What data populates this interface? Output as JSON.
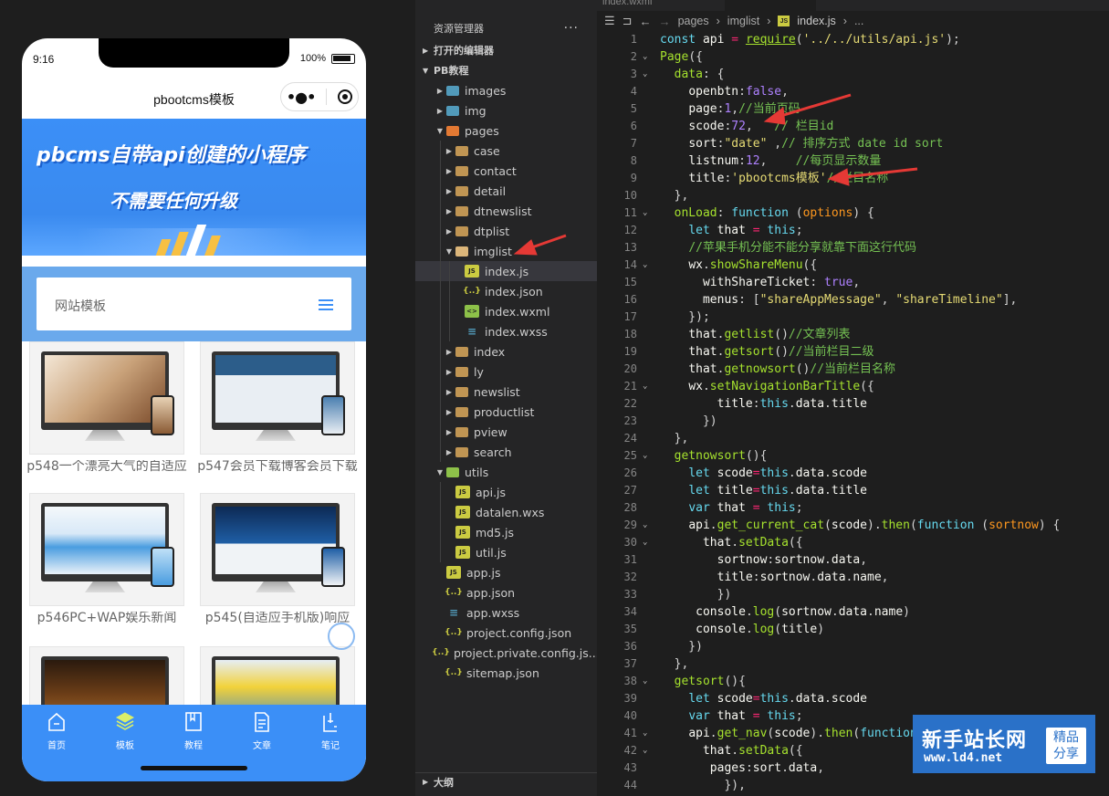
{
  "simulator": {
    "time": "9:16",
    "battery": "100%",
    "nav_title": "pbootcms模板",
    "banner_line1": "pbcms自带api创建的小程序",
    "banner_line2": "不需要任何升级",
    "section_title": "网站模板",
    "items": [
      {
        "label": "p548一个漂亮大气的自适应"
      },
      {
        "label": "p547会员下载博客会员下载"
      },
      {
        "label": "p546PC+WAP娱乐新闻"
      },
      {
        "label": "p545(自适应手机版)响应"
      },
      {
        "label": ""
      },
      {
        "label": ""
      }
    ],
    "tabs": [
      {
        "label": "首页",
        "icon": "home-icon"
      },
      {
        "label": "模板",
        "icon": "layers-icon"
      },
      {
        "label": "教程",
        "icon": "book-icon"
      },
      {
        "label": "文章",
        "icon": "document-icon"
      },
      {
        "label": "笔记",
        "icon": "note-icon"
      }
    ],
    "accent": "#3b8ff7"
  },
  "explorer": {
    "header": "资源管理器",
    "more": "···",
    "open_editors": "打开的编辑器",
    "project": "PB教程",
    "outline": "大纲",
    "tree": [
      {
        "label": "images",
        "depth": 1,
        "type": "folder-img",
        "arrow": "›"
      },
      {
        "label": "img",
        "depth": 1,
        "type": "folder-img",
        "arrow": "›"
      },
      {
        "label": "pages",
        "depth": 1,
        "type": "folder-pages",
        "arrow": "⌄"
      },
      {
        "label": "case",
        "depth": 2,
        "type": "folder",
        "arrow": "›"
      },
      {
        "label": "contact",
        "depth": 2,
        "type": "folder",
        "arrow": "›"
      },
      {
        "label": "detail",
        "depth": 2,
        "type": "folder",
        "arrow": "›"
      },
      {
        "label": "dtnewslist",
        "depth": 2,
        "type": "folder",
        "arrow": "›"
      },
      {
        "label": "dtplist",
        "depth": 2,
        "type": "folder",
        "arrow": "›"
      },
      {
        "label": "imglist",
        "depth": 2,
        "type": "folder-open",
        "arrow": "⌄"
      },
      {
        "label": "index.js",
        "depth": 3,
        "type": "js",
        "arrow": "",
        "selected": true
      },
      {
        "label": "index.json",
        "depth": 3,
        "type": "json",
        "arrow": ""
      },
      {
        "label": "index.wxml",
        "depth": 3,
        "type": "wxml",
        "arrow": ""
      },
      {
        "label": "index.wxss",
        "depth": 3,
        "type": "wxss",
        "arrow": ""
      },
      {
        "label": "index",
        "depth": 2,
        "type": "folder",
        "arrow": "›"
      },
      {
        "label": "ly",
        "depth": 2,
        "type": "folder",
        "arrow": "›"
      },
      {
        "label": "newslist",
        "depth": 2,
        "type": "folder",
        "arrow": "›"
      },
      {
        "label": "productlist",
        "depth": 2,
        "type": "folder",
        "arrow": "›"
      },
      {
        "label": "pview",
        "depth": 2,
        "type": "folder",
        "arrow": "›"
      },
      {
        "label": "search",
        "depth": 2,
        "type": "folder",
        "arrow": "›"
      },
      {
        "label": "utils",
        "depth": 1,
        "type": "folder-utils",
        "arrow": "⌄"
      },
      {
        "label": "api.js",
        "depth": 2,
        "type": "js",
        "arrow": ""
      },
      {
        "label": "datalen.wxs",
        "depth": 2,
        "type": "js",
        "arrow": ""
      },
      {
        "label": "md5.js",
        "depth": 2,
        "type": "js",
        "arrow": ""
      },
      {
        "label": "util.js",
        "depth": 2,
        "type": "js",
        "arrow": ""
      },
      {
        "label": "app.js",
        "depth": 1,
        "type": "js",
        "arrow": ""
      },
      {
        "label": "app.json",
        "depth": 1,
        "type": "json",
        "arrow": ""
      },
      {
        "label": "app.wxss",
        "depth": 1,
        "type": "wxss",
        "arrow": ""
      },
      {
        "label": "project.config.json",
        "depth": 1,
        "type": "json",
        "arrow": ""
      },
      {
        "label": "project.private.config.js...",
        "depth": 1,
        "type": "json",
        "arrow": ""
      },
      {
        "label": "sitemap.json",
        "depth": 1,
        "type": "json",
        "arrow": ""
      }
    ]
  },
  "editor": {
    "tab_inactive": "index.wxml",
    "tab_active": "index.js",
    "breadcrumb": [
      "pages",
      "imglist",
      "index.js",
      "..."
    ],
    "lines": [
      {
        "n": "1",
        "fold": "",
        "html": "<span class='k2'>const</span> <span class='id'>api</span> <span class='k'>=</span> <span class='fn u'>require</span>(<span class='s'>'../../utils/api.js'</span>);"
      },
      {
        "n": "2",
        "fold": "⌄",
        "html": "<span class='fn'>Page</span>({"
      },
      {
        "n": "3",
        "fold": "⌄",
        "html": "  <span class='fn'>data</span>: {"
      },
      {
        "n": "4",
        "fold": "",
        "html": "    <span class='prop'>openbtn</span>:<span class='n'>false</span>,"
      },
      {
        "n": "5",
        "fold": "",
        "html": "    <span class='prop'>page</span>:<span class='n'>1</span>,<span class='c'>//当前页码</span>"
      },
      {
        "n": "6",
        "fold": "",
        "html": "    <span class='prop'>scode</span>:<span class='n'>72</span>,   <span class='c'>// 栏目id</span>"
      },
      {
        "n": "7",
        "fold": "",
        "html": "    <span class='prop'>sort</span>:<span class='s'>\"date\"</span> ,<span class='c'>// 排序方式 date id sort</span>"
      },
      {
        "n": "8",
        "fold": "",
        "html": "    <span class='prop'>listnum</span>:<span class='n'>12</span>,    <span class='c'>//每页显示数量</span>"
      },
      {
        "n": "9",
        "fold": "",
        "html": "    <span class='prop'>title</span>:<span class='s'>'pbootcms模板'</span><span class='c'>//栏目名称</span>"
      },
      {
        "n": "10",
        "fold": "",
        "html": "  },"
      },
      {
        "n": "11",
        "fold": "⌄",
        "html": "  <span class='fn'>onLoad</span>: <span class='k2'>function</span> (<span class='param'>options</span>) {"
      },
      {
        "n": "12",
        "fold": "",
        "html": "    <span class='k2'>let</span> <span class='id'>that</span> <span class='k'>=</span> <span class='k2'>this</span>;"
      },
      {
        "n": "13",
        "fold": "",
        "html": "    <span class='c'>//苹果手机分能不能分享就靠下面这行代码</span>"
      },
      {
        "n": "14",
        "fold": "⌄",
        "html": "    <span class='id'>wx</span>.<span class='fn'>showShareMenu</span>({"
      },
      {
        "n": "15",
        "fold": "",
        "html": "      <span class='prop'>withShareTicket</span>: <span class='n'>true</span>,"
      },
      {
        "n": "16",
        "fold": "",
        "html": "      <span class='prop'>menus</span>: [<span class='s'>\"shareAppMessage\"</span>, <span class='s'>\"shareTimeline\"</span>],"
      },
      {
        "n": "17",
        "fold": "",
        "html": "    });"
      },
      {
        "n": "18",
        "fold": "",
        "html": "    <span class='id'>that</span>.<span class='fn'>getlist</span>()<span class='c'>//文章列表</span>"
      },
      {
        "n": "19",
        "fold": "",
        "html": "    <span class='id'>that</span>.<span class='fn'>getsort</span>()<span class='c'>//当前栏目二级</span>"
      },
      {
        "n": "20",
        "fold": "",
        "html": "    <span class='id'>that</span>.<span class='fn'>getnowsort</span>()<span class='c'>//当前栏目名称</span>"
      },
      {
        "n": "21",
        "fold": "⌄",
        "html": "    <span class='id'>wx</span>.<span class='fn'>setNavigationBarTitle</span>({"
      },
      {
        "n": "22",
        "fold": "",
        "html": "        <span class='prop'>title</span>:<span class='k2'>this</span>.<span class='id'>data</span>.<span class='id'>title</span>"
      },
      {
        "n": "23",
        "fold": "",
        "html": "      })"
      },
      {
        "n": "24",
        "fold": "",
        "html": "  },"
      },
      {
        "n": "25",
        "fold": "⌄",
        "html": "  <span class='fn'>getnowsort</span>(){"
      },
      {
        "n": "26",
        "fold": "",
        "html": "    <span class='k2'>let</span> <span class='id'>scode</span><span class='k'>=</span><span class='k2'>this</span>.<span class='id'>data</span>.<span class='id'>scode</span>"
      },
      {
        "n": "27",
        "fold": "",
        "html": "    <span class='k2'>let</span> <span class='id'>title</span><span class='k'>=</span><span class='k2'>this</span>.<span class='id'>data</span>.<span class='id'>title</span>"
      },
      {
        "n": "28",
        "fold": "",
        "html": "    <span class='k2'>var</span> <span class='id'>that</span> <span class='k'>=</span> <span class='k2'>this</span>;"
      },
      {
        "n": "29",
        "fold": "⌄",
        "html": "    <span class='id'>api</span>.<span class='fn'>get_current_cat</span>(<span class='id'>scode</span>).<span class='fn'>then</span>(<span class='k2'>function</span> (<span class='param'>sortnow</span>) {"
      },
      {
        "n": "30",
        "fold": "⌄",
        "html": "      <span class='id'>that</span>.<span class='fn'>setData</span>({"
      },
      {
        "n": "31",
        "fold": "",
        "html": "        <span class='prop'>sortnow</span>:<span class='id'>sortnow</span>.<span class='id'>data</span>,"
      },
      {
        "n": "32",
        "fold": "",
        "html": "        <span class='prop'>title</span>:<span class='id'>sortnow</span>.<span class='id'>data</span>.<span class='id'>name</span>,"
      },
      {
        "n": "33",
        "fold": "",
        "html": "        })"
      },
      {
        "n": "34",
        "fold": "",
        "html": "     <span class='id'>console</span>.<span class='fn'>log</span>(<span class='id'>sortnow</span>.<span class='id'>data</span>.<span class='id'>name</span>)"
      },
      {
        "n": "35",
        "fold": "",
        "html": "     <span class='id'>console</span>.<span class='fn'>log</span>(<span class='id'>title</span>)"
      },
      {
        "n": "36",
        "fold": "",
        "html": "    })"
      },
      {
        "n": "37",
        "fold": "",
        "html": "  },"
      },
      {
        "n": "38",
        "fold": "⌄",
        "html": "  <span class='fn'>getsort</span>(){"
      },
      {
        "n": "39",
        "fold": "",
        "html": "    <span class='k2'>let</span> <span class='id'>scode</span><span class='k'>=</span><span class='k2'>this</span>.<span class='id'>data</span>.<span class='id'>scode</span>"
      },
      {
        "n": "40",
        "fold": "",
        "html": "    <span class='k2'>var</span> <span class='id'>that</span> <span class='k'>=</span> <span class='k2'>this</span>;"
      },
      {
        "n": "41",
        "fold": "⌄",
        "html": "    <span class='id'>api</span>.<span class='fn'>get_nav</span>(<span class='id'>scode</span>).<span class='fn'>then</span>(<span class='k2'>function</span>"
      },
      {
        "n": "42",
        "fold": "⌄",
        "html": "      <span class='id'>that</span>.<span class='fn'>setData</span>({"
      },
      {
        "n": "43",
        "fold": "",
        "html": "       <span class='prop'>pages</span>:<span class='id'>sort</span>.<span class='id'>data</span>,"
      },
      {
        "n": "44",
        "fold": "",
        "html": "         }),"
      }
    ]
  },
  "watermark": {
    "title": "新手站长网",
    "url": "www.ld4.net",
    "badge_line1": "精品",
    "badge_line2": "分享"
  },
  "colors": {
    "annotation_arrow": "#e53935",
    "editor_bg": "#1e1e1e",
    "explorer_bg": "#252526"
  }
}
